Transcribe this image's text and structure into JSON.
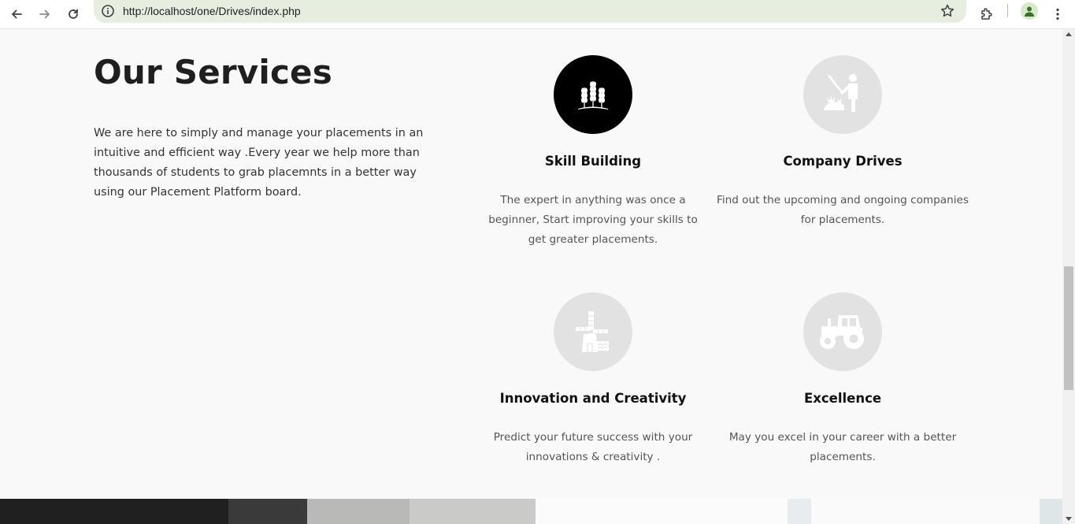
{
  "browser": {
    "url": "http://localhost/one/Drives/index.php",
    "icons": [
      "back-icon",
      "forward-icon",
      "reload-icon",
      "site-info-icon",
      "bookmark-star-icon",
      "extensions-icon",
      "profile-icon",
      "menu-dots-icon"
    ]
  },
  "services": {
    "title": "Our Services",
    "intro": "We are here to simply and manage your placements in an intuitive and efficient way .Every year we help more than thousands of students to grab placemnts in a better way using our Placement Platform board.",
    "cards": [
      {
        "title": "Skill Building",
        "description": "The expert in anything was once a beginner, Start improving your skills to get greater placements.",
        "icon": "wheat-icon",
        "highlighted": true
      },
      {
        "title": "Company Drives",
        "description": "Find out the upcoming and ongoing companies for placements.",
        "icon": "farmer-icon",
        "highlighted": false
      },
      {
        "title": "Innovation and Creativity",
        "description": "Predict your future success with your innovations & creativity .",
        "icon": "windmill-icon",
        "highlighted": false
      },
      {
        "title": "Excellence",
        "description": "May you excel in your career with a better placements.",
        "icon": "tractor-icon",
        "highlighted": false
      }
    ]
  },
  "colors": {
    "page_background": "#f9f9f9",
    "highlight_circle": "#000000",
    "icon_circle": "#e2e2e2",
    "omnibox": "#e6efdf"
  }
}
